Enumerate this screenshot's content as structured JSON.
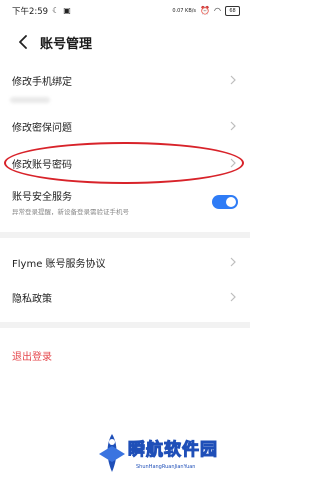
{
  "status_bar": {
    "time": "下午2:59",
    "icons_left": [
      "moon-icon",
      "notification-icon"
    ],
    "net_speed": "0.07 KB/s",
    "battery": "68"
  },
  "header": {
    "title": "账号管理"
  },
  "rows": [
    {
      "label": "修改手机绑定"
    },
    {
      "label": "修改密保问题"
    },
    {
      "label": "修改账号密码"
    },
    {
      "label": "账号安全服务",
      "sub": "异常登录提醒，新设备登录需验证手机号",
      "toggle_on": true
    },
    {
      "label": "Flyme 账号服务协议"
    },
    {
      "label": "隐私政策"
    }
  ],
  "logout": {
    "label": "退出登录"
  },
  "colors": {
    "accent": "#2f7cf6",
    "danger": "#e5484d",
    "highlight": "#d8232a"
  },
  "watermark": {
    "main": "瞬航软件园",
    "pinyin": "ShunHangRuanJianYuan"
  }
}
